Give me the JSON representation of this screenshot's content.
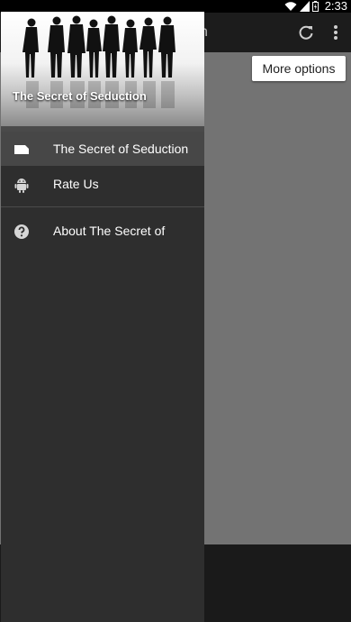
{
  "status_bar": {
    "time": "2:33",
    "icons": [
      "wifi-icon",
      "signal-icon",
      "battery-icon"
    ]
  },
  "app": {
    "title_fragment": "n",
    "refresh_icon": "refresh-icon",
    "overflow_icon": "overflow-menu-icon",
    "more_options_label": "More options"
  },
  "drawer": {
    "header_title": "The Secret of Seduction",
    "items": [
      {
        "label": "The Secret of Seduction",
        "icon": "label-tag-icon",
        "active": true
      },
      {
        "label": "Rate Us",
        "icon": "android-icon",
        "active": false
      },
      {
        "label": "About The Secret of",
        "icon": "help-circle-icon",
        "active": false
      }
    ]
  },
  "colors": {
    "drawer_bg": "#2e2e2e",
    "active_item_bg": "#474747",
    "content_bg": "#737373"
  }
}
